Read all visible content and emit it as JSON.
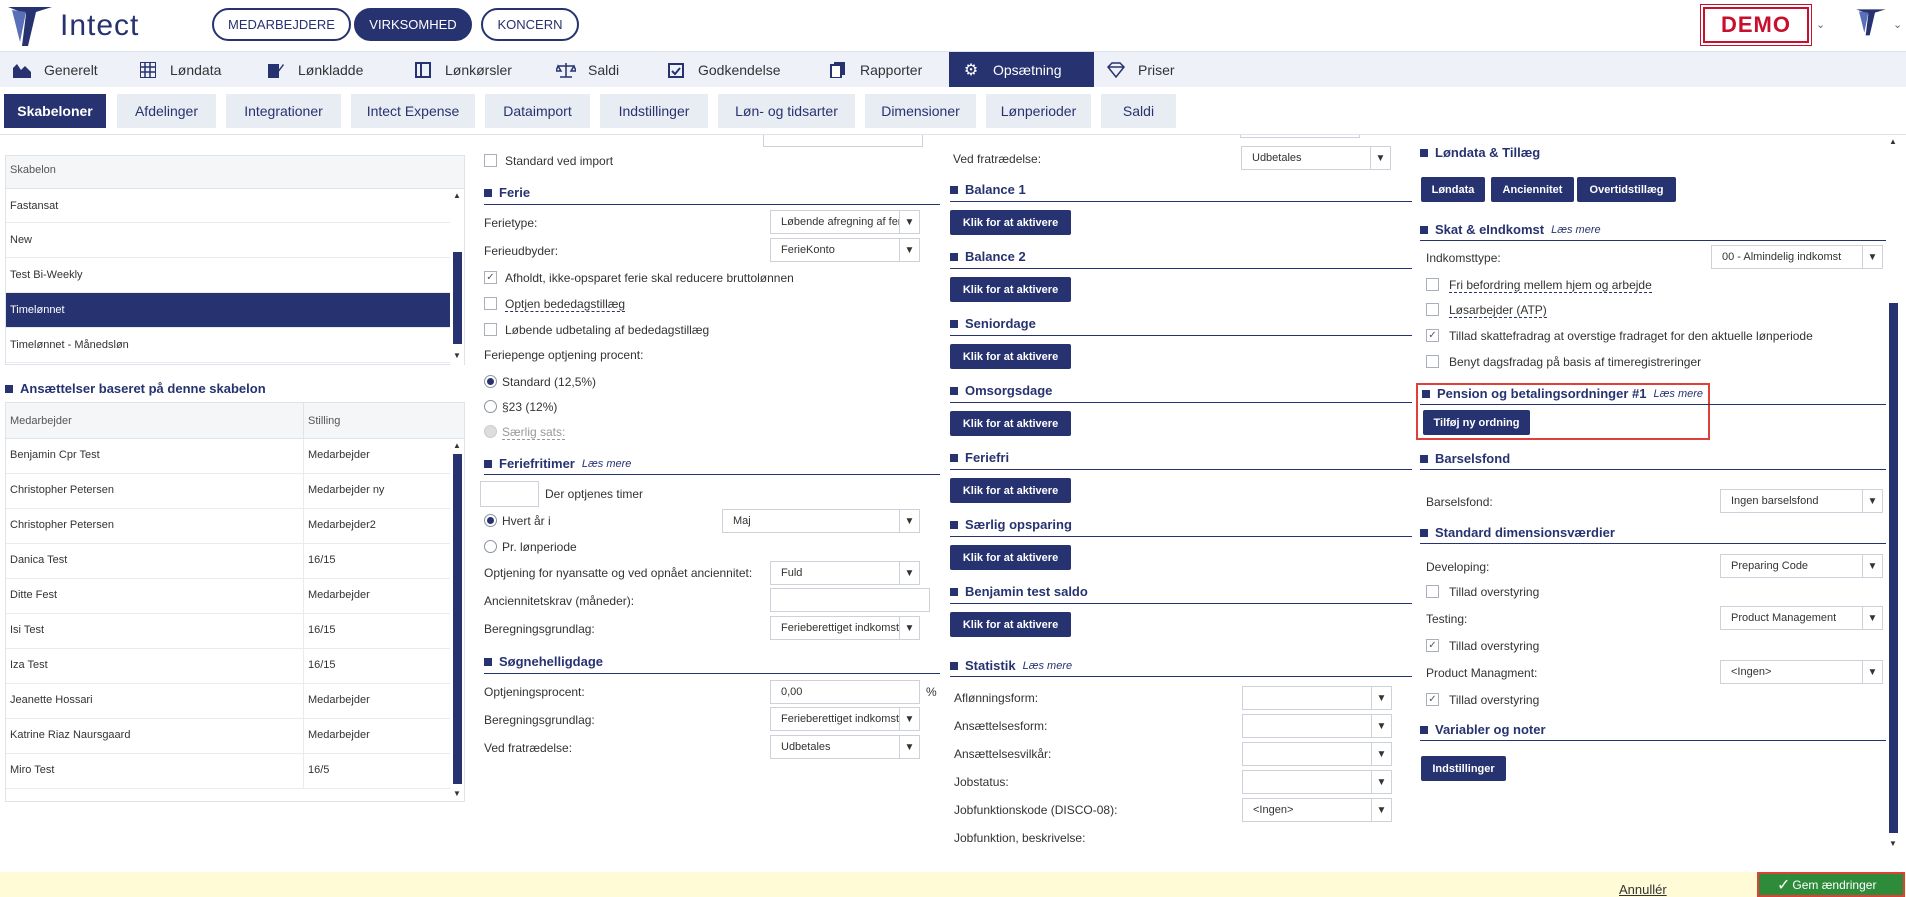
{
  "app": {
    "logo_text": "Intect",
    "demo": "DEMO"
  },
  "scope_tabs": [
    {
      "label": "MEDARBEJDERE"
    },
    {
      "label": "VIRKSOMHED"
    },
    {
      "label": "KONCERN"
    }
  ],
  "main_nav": [
    {
      "label": "Generelt",
      "icon": "chart-icon"
    },
    {
      "label": "Løndata",
      "icon": "grid-icon"
    },
    {
      "label": "Lønkladde",
      "icon": "edit-icon"
    },
    {
      "label": "Lønkørsler",
      "icon": "window-icon"
    },
    {
      "label": "Saldi",
      "icon": "scale-icon"
    },
    {
      "label": "Godkendelse",
      "icon": "calendar-check-icon"
    },
    {
      "label": "Rapporter",
      "icon": "copy-icon"
    },
    {
      "label": "Opsætning",
      "icon": "gear-icon"
    },
    {
      "label": "Priser",
      "icon": "diamond-icon"
    }
  ],
  "sub_nav": [
    "Skabeloner",
    "Afdelinger",
    "Integrationer",
    "Intect Expense",
    "Dataimport",
    "Indstillinger",
    "Løn- og tidsarter",
    "Dimensioner",
    "Lønperioder",
    "Saldi"
  ],
  "templates": {
    "header": "Skabelon",
    "items": [
      "Fastansat",
      "New",
      "Test Bi-Weekly",
      "Timelønnet",
      "Timelønnet - Månedsløn"
    ],
    "selected": 3
  },
  "employments": {
    "title": "Ansættelser baseret på denne skabelon",
    "col1": "Medarbejder",
    "col2": "Stilling",
    "rows": [
      [
        "Benjamin Cpr Test",
        "Medarbejder"
      ],
      [
        "Christopher Petersen",
        "Medarbejder ny"
      ],
      [
        "Christopher Petersen",
        "Medarbejder2"
      ],
      [
        "Danica Test",
        "16/15"
      ],
      [
        "Ditte Fest",
        "Medarbejder"
      ],
      [
        "Isi Test",
        "16/15"
      ],
      [
        "Iza Test",
        "16/15"
      ],
      [
        "Jeanette Hossari",
        "Medarbejder"
      ],
      [
        "Katrine Riaz Naursgaard",
        "Medarbejder"
      ],
      [
        "Miro Test",
        "16/5"
      ]
    ]
  },
  "col2": {
    "std_import": "Standard ved import",
    "ferie": {
      "title": "Ferie",
      "type_label": "Ferietype:",
      "type_value": "Løbende afregning af feriep",
      "provider_label": "Ferieudbyder:",
      "provider_value": "FerieKonto",
      "cb1": "Afholdt, ikke-opsparet ferie skal reducere bruttolønnen",
      "cb2": "Optjen bededagstillæg",
      "cb3": "Løbende udbetaling af bededagstillæg",
      "pct_label": "Feriepenge optjening procent:",
      "r1": "Standard (12,5%)",
      "r2": "§23 (12%)",
      "r3": "Særlig sats:"
    },
    "feriefri": {
      "title": "Feriefritimer",
      "more": "Læs mere",
      "hours_label": "Der optjenes timer",
      "r1": "Hvert år i",
      "month": "Maj",
      "r2": "Pr. lønperiode",
      "new_label": "Optjening for nyansatte og ved opnået anciennitet:",
      "new_value": "Fuld",
      "senior_label": "Anciennitetskrav (måneder):",
      "basis_label": "Beregningsgrundlag:",
      "basis_value": "Ferieberettiget indkomst"
    },
    "soegne": {
      "title": "Søgnehelligdage",
      "pct_label": "Optjeningsprocent:",
      "pct_value": "0,00",
      "pct_unit": "%",
      "basis_label": "Beregningsgrundlag:",
      "basis_value": "Ferieberettiget indkomst",
      "resign_label": "Ved fratrædelse:",
      "resign_value": "Udbetales"
    }
  },
  "col3": {
    "resign_label": "Ved fratrædelse:",
    "resign_value": "Udbetales",
    "activate": "Klik for at aktivere",
    "sections": [
      "Balance 1",
      "Balance 2",
      "Seniordage",
      "Omsorgsdage",
      "Feriefri",
      "Særlig opsparing",
      "Benjamin test saldo"
    ],
    "stat": {
      "title": "Statistik",
      "more": "Læs mere",
      "f1": "Aflønningsform:",
      "f2": "Ansættelsesform:",
      "f3": "Ansættelsesvilkår:",
      "f4": "Jobstatus:",
      "f5": "Jobfunktionskode (DISCO-08):",
      "f5_value": "<Ingen>",
      "f6": "Jobfunktion, beskrivelse:"
    }
  },
  "col4": {
    "loen": {
      "title": "Løndata & Tillæg",
      "b1": "Løndata",
      "b2": "Anciennitet",
      "b3": "Overtidstillæg"
    },
    "skat": {
      "title": "Skat & eIndkomst",
      "more": "Læs mere",
      "type_label": "Indkomsttype:",
      "type_value": "00 - Almindelig indkomst",
      "cb1": "Fri befordring mellem hjem og arbejde",
      "cb2": "Løsarbejder (ATP)",
      "cb3": "Tillad skattefradrag at overstige fradraget for den aktuelle lønperiode",
      "cb4": "Benyt dagsfradag på basis af timeregistreringer"
    },
    "pension": {
      "title": "Pension og betalingsordninger #1",
      "more": "Læs mere",
      "button": "Tilføj ny ordning"
    },
    "barsel": {
      "title": "Barselsfond",
      "label": "Barselsfond:",
      "value": "Ingen barselsfond"
    },
    "dim": {
      "title": "Standard dimensionsværdier",
      "d1": "Developing:",
      "d1v": "Preparing Code",
      "d2": "Testing:",
      "d2v": "Product Management",
      "d3": "Product Managment:",
      "d3v": "<Ingen>",
      "override": "Tillad overstyring"
    },
    "var": {
      "title": "Variabler og noter",
      "button": "Indstillinger"
    }
  },
  "footer": {
    "cancel": "Annullér",
    "save": "Gem ændringer"
  }
}
